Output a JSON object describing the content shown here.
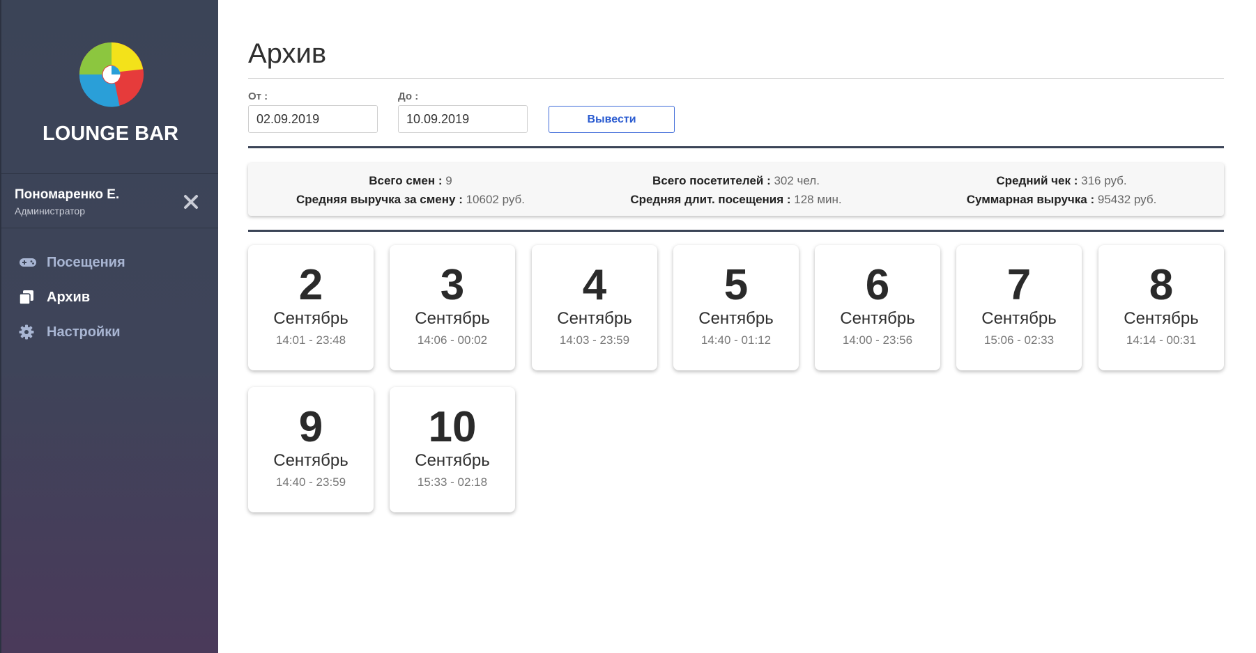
{
  "brand": {
    "name": "LOUNGE BAR",
    "logo_icon": "swirl-logo-icon"
  },
  "user": {
    "name": "Пономаренко Е.",
    "role": "Администратор"
  },
  "nav": {
    "items": [
      {
        "label": "Посещения",
        "icon": "gamepad-icon",
        "active": false
      },
      {
        "label": "Архив",
        "icon": "copy-icon",
        "active": true
      },
      {
        "label": "Настройки",
        "icon": "gear-icon",
        "active": false
      }
    ]
  },
  "page": {
    "title": "Архив"
  },
  "filter": {
    "from_label": "От :",
    "from_value": "02.09.2019",
    "to_label": "До :",
    "to_value": "10.09.2019",
    "submit_label": "Вывести"
  },
  "summary": {
    "shifts_label": "Всего смен :",
    "shifts_value": " 9",
    "avg_revenue_label": "Средняя выручка за смену :",
    "avg_revenue_value": " 10602 руб.",
    "visitors_label": "Всего посетителей :",
    "visitors_value": " 302 чел.",
    "avg_duration_label": "Средняя длит. посещения :",
    "avg_duration_value": " 128 мин.",
    "avg_check_label": "Средний чек :",
    "avg_check_value": " 316 руб.",
    "total_revenue_label": "Суммарная выручка :",
    "total_revenue_value": " 95432 руб."
  },
  "shifts": [
    {
      "day": "2",
      "month": "Сентябрь",
      "time": "14:01 - 23:48"
    },
    {
      "day": "3",
      "month": "Сентябрь",
      "time": "14:06 - 00:02"
    },
    {
      "day": "4",
      "month": "Сентябрь",
      "time": "14:03 - 23:59"
    },
    {
      "day": "5",
      "month": "Сентябрь",
      "time": "14:40 - 01:12"
    },
    {
      "day": "6",
      "month": "Сентябрь",
      "time": "14:00 - 23:56"
    },
    {
      "day": "7",
      "month": "Сентябрь",
      "time": "15:06 - 02:33"
    },
    {
      "day": "8",
      "month": "Сентябрь",
      "time": "14:14 - 00:31"
    },
    {
      "day": "9",
      "month": "Сентябрь",
      "time": "14:40 - 23:59"
    },
    {
      "day": "10",
      "month": "Сентябрь",
      "time": "15:33 - 02:18"
    }
  ],
  "colors": {
    "sidebar": "#3b4457",
    "accent": "#3d6ad8",
    "nav_text": "#a9b6d3"
  }
}
